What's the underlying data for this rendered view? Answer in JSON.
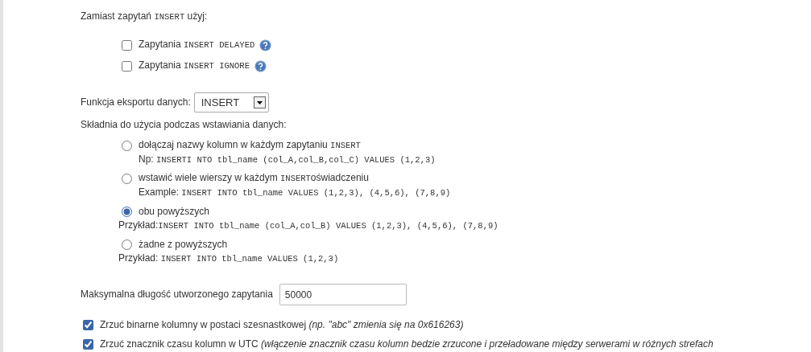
{
  "insert_options": {
    "heading": [
      {
        "text": "Zamiast zapytań ",
        "kind": "plain"
      },
      {
        "text": "INSERT",
        "kind": "code"
      },
      {
        "text": " użyj:",
        "kind": "plain"
      }
    ],
    "items": [
      {
        "checked": false,
        "label": [
          {
            "text": "Zapytania ",
            "kind": "plain"
          },
          {
            "text": "INSERT DELAYED",
            "kind": "code"
          }
        ]
      },
      {
        "checked": false,
        "label": [
          {
            "text": "Zapytania ",
            "kind": "plain"
          },
          {
            "text": "INSERT IGNORE",
            "kind": "code"
          }
        ]
      }
    ]
  },
  "export_function": {
    "label": "Funkcja eksportu danych:",
    "value": "INSERT"
  },
  "syntax": {
    "heading": "Składnia do użycia podczas wstawiania danych:",
    "options": [
      {
        "selected": false,
        "label": [
          {
            "text": "dołączaj nazwy kolumn w każdym zapytaniu ",
            "kind": "plain"
          },
          {
            "text": "INSERT",
            "kind": "code"
          }
        ],
        "example": [
          {
            "text": "Np: ",
            "kind": "plain"
          },
          {
            "text": "INSERTI NTO tbl_name (col_A,col_B,col_C) VALUES (1,2,3)",
            "kind": "code"
          }
        ]
      },
      {
        "selected": false,
        "label": [
          {
            "text": "wstawić wiele wierszy w każdym ",
            "kind": "plain"
          },
          {
            "text": "INSERT",
            "kind": "code"
          },
          {
            "text": "oświadczeniu",
            "kind": "plain"
          }
        ],
        "example": [
          {
            "text": "Example: ",
            "kind": "plain"
          },
          {
            "text": "INSERT INTO tbl_name VALUES (1,2,3), (4,5,6), (7,8,9)",
            "kind": "code"
          }
        ]
      },
      {
        "selected": true,
        "label": [
          {
            "text": "obu powyższych",
            "kind": "plain"
          }
        ],
        "example": [
          {
            "text": "Przykład:",
            "kind": "plain"
          },
          {
            "text": "INSERT INTO tbl_name (col_A,col_B) VALUES (1,2,3), (4,5,6), (7,8,9)",
            "kind": "code"
          }
        ]
      },
      {
        "selected": false,
        "label": [
          {
            "text": "żadne z powyższych",
            "kind": "plain"
          }
        ],
        "example": [
          {
            "text": "Przykład: ",
            "kind": "plain"
          },
          {
            "text": "INSERT INTO tbl_name VALUES (1,2,3)",
            "kind": "code"
          }
        ]
      }
    ]
  },
  "max_query_length": {
    "label": "Maksymalna długość utworzonego zapytania",
    "value": "50000"
  },
  "dump_options": [
    {
      "checked": true,
      "label": [
        {
          "text": "Zrzuć binarne kolumny w postaci szesnastkowej ",
          "kind": "plain"
        },
        {
          "text": "(np. \"abc\" zmienia się na 0x616263)",
          "kind": "note"
        }
      ]
    },
    {
      "checked": true,
      "label": [
        {
          "text": "Zrzuć znacznik czasu kolumn w UTC ",
          "kind": "plain"
        },
        {
          "text": "(włączenie znacznik czasu kolumn bedzie zrzucone i przeładowane między serwerami w różnych strefach",
          "kind": "note"
        }
      ]
    }
  ]
}
